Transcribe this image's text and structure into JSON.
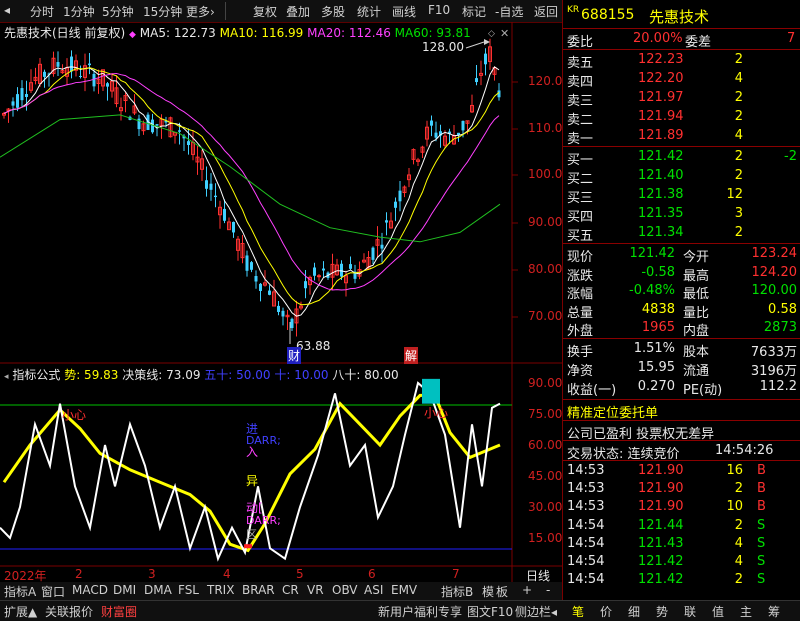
{
  "toolbar": {
    "items": [
      "分时",
      "1分钟",
      "5分钟",
      "15分钟",
      "更多›",
      "复权",
      "叠加",
      "多股",
      "统计",
      "画线",
      "F10",
      "标记",
      "-自选",
      "返回"
    ]
  },
  "stock": {
    "badge": "KR",
    "code": "688155",
    "name": "先惠技术"
  },
  "main_chart": {
    "title": "先惠技术(日线 前复权)",
    "ma5": "MA5: 122.73",
    "ma10": "MA10: 116.99",
    "ma20": "MA20: 112.46",
    "ma60": "MA60: 93.81",
    "high_label": "128.00",
    "low_label": "63.88",
    "marker_cai": "财",
    "marker_jie": "解",
    "y_ticks": [
      "120.0",
      "110.0",
      "100.0",
      "90.00",
      "80.00",
      "70.00"
    ]
  },
  "indicator": {
    "name": "指标公式",
    "shi_label": "势: 59.83",
    "jueche": "决策线: 73.09",
    "wushi": "五十: 50.00",
    "shi10": "十: 10.00",
    "bashi": "八十: 80.00",
    "y_ticks": [
      "90.00",
      "75.00",
      "60.00",
      "45.00",
      "30.00",
      "15.00"
    ],
    "ann_xiaoxin1": "小心",
    "ann_xiaoxin2": "小心",
    "ann_jin": "进",
    "ann_ru": "入",
    "ann_darr1": "DARR;",
    "ann_yi": "异",
    "ann_dong": "动[",
    "ann_darr2": "DARR;",
    "ann_x": "区"
  },
  "date_axis": {
    "labels": [
      "2022年",
      "2",
      "3",
      "4",
      "5",
      "6",
      "7"
    ],
    "period": "日线"
  },
  "tabs": [
    "指标A",
    "窗口",
    "MACD",
    "DMI",
    "DMA",
    "FSL",
    "TRIX",
    "BRAR",
    "CR",
    "VR",
    "OBV",
    "ASI",
    "EMV",
    "指标B",
    "模",
    "板",
    "+",
    "-"
  ],
  "order_book": {
    "weibi_label": "委比",
    "weibi_val": "20.00%",
    "weicha_label": "委差",
    "weicha_val": "7",
    "sells": [
      {
        "label": "卖五",
        "price": "122.23",
        "vol": "2"
      },
      {
        "label": "卖四",
        "price": "122.20",
        "vol": "4"
      },
      {
        "label": "卖三",
        "price": "121.97",
        "vol": "2"
      },
      {
        "label": "卖二",
        "price": "121.94",
        "vol": "2"
      },
      {
        "label": "卖一",
        "price": "121.89",
        "vol": "4"
      }
    ],
    "buys": [
      {
        "label": "买一",
        "price": "121.42",
        "vol": "2",
        "chg": "-2"
      },
      {
        "label": "买二",
        "price": "121.40",
        "vol": "2",
        "chg": ""
      },
      {
        "label": "买三",
        "price": "121.38",
        "vol": "12",
        "chg": ""
      },
      {
        "label": "买四",
        "price": "121.35",
        "vol": "3",
        "chg": ""
      },
      {
        "label": "买五",
        "price": "121.34",
        "vol": "2",
        "chg": ""
      }
    ]
  },
  "quote": {
    "rows": [
      {
        "l1": "现价",
        "v1": "121.42",
        "l2": "今开",
        "v2": "123.24"
      },
      {
        "l1": "涨跌",
        "v1": "-0.58",
        "l2": "最高",
        "v2": "124.20"
      },
      {
        "l1": "涨幅",
        "v1": "-0.48%",
        "l2": "最低",
        "v2": "120.00"
      },
      {
        "l1": "总量",
        "v1": "4838",
        "l2": "量比",
        "v2": "0.58"
      },
      {
        "l1": "外盘",
        "v1": "1965",
        "l2": "内盘",
        "v2": "2873"
      }
    ],
    "rows2": [
      {
        "l1": "换手",
        "v1": "1.51%",
        "l2": "股本",
        "v2": "7633万"
      },
      {
        "l1": "净资",
        "v1": "15.95",
        "l2": "流通",
        "v2": "3196万"
      },
      {
        "l1": "收益(一)",
        "v1": "0.270",
        "l2": "PE(动)",
        "v2": "112.2"
      }
    ]
  },
  "info": {
    "line1": "精准定位委托单",
    "line2": "公司已盈利 投票权无差异",
    "line3_label": "交易状态: 连续竞价",
    "line3_time": "14:54:26"
  },
  "trades": [
    {
      "time": "14:53",
      "price": "121.90",
      "vol": "16",
      "side": "B"
    },
    {
      "time": "14:53",
      "price": "121.90",
      "vol": "2",
      "side": "B"
    },
    {
      "time": "14:53",
      "price": "121.90",
      "vol": "10",
      "side": "B"
    },
    {
      "time": "14:54",
      "price": "121.44",
      "vol": "2",
      "side": "S"
    },
    {
      "time": "14:54",
      "price": "121.43",
      "vol": "4",
      "side": "S"
    },
    {
      "time": "14:54",
      "price": "121.42",
      "vol": "4",
      "side": "S"
    },
    {
      "time": "14:54",
      "price": "121.42",
      "vol": "2",
      "side": "S"
    }
  ],
  "bottombar": {
    "left": [
      "扩展▲",
      "关联报价",
      "财富圈"
    ],
    "mid": [
      "新用户福利专享",
      "图文F10",
      "侧边栏◂"
    ],
    "right": [
      "笔",
      "价",
      "细",
      "势",
      "联",
      "值",
      "主",
      "筹"
    ]
  }
}
